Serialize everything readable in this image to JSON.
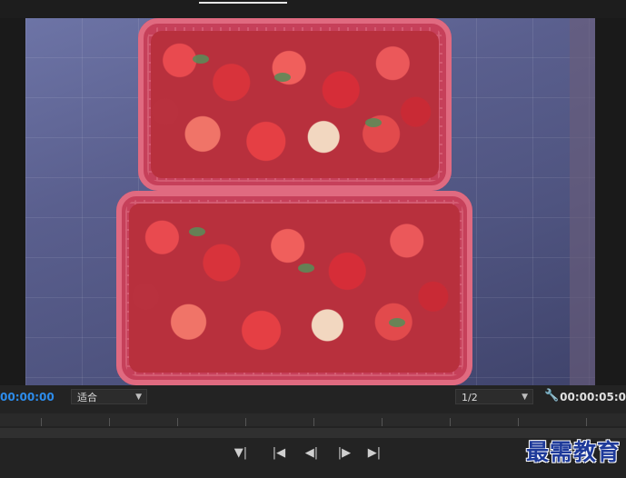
{
  "player": {
    "current_timecode": "00:00:00",
    "duration_timecode": "00:00:05:0",
    "fit_select": {
      "value": "适合"
    },
    "resolution_select": {
      "value": "1/2"
    }
  },
  "icons": {
    "settings": "wrench-icon",
    "add_marker": "add-marker-icon",
    "mark_in": "mark-in-icon",
    "step_back": "step-back-icon",
    "step_forward": "step-forward-icon",
    "mark_out": "mark-out-icon"
  },
  "watermark": {
    "text": "最需教育"
  },
  "colors": {
    "accent_timecode": "#2d8ceb",
    "watermark": "#1e3a9a"
  }
}
